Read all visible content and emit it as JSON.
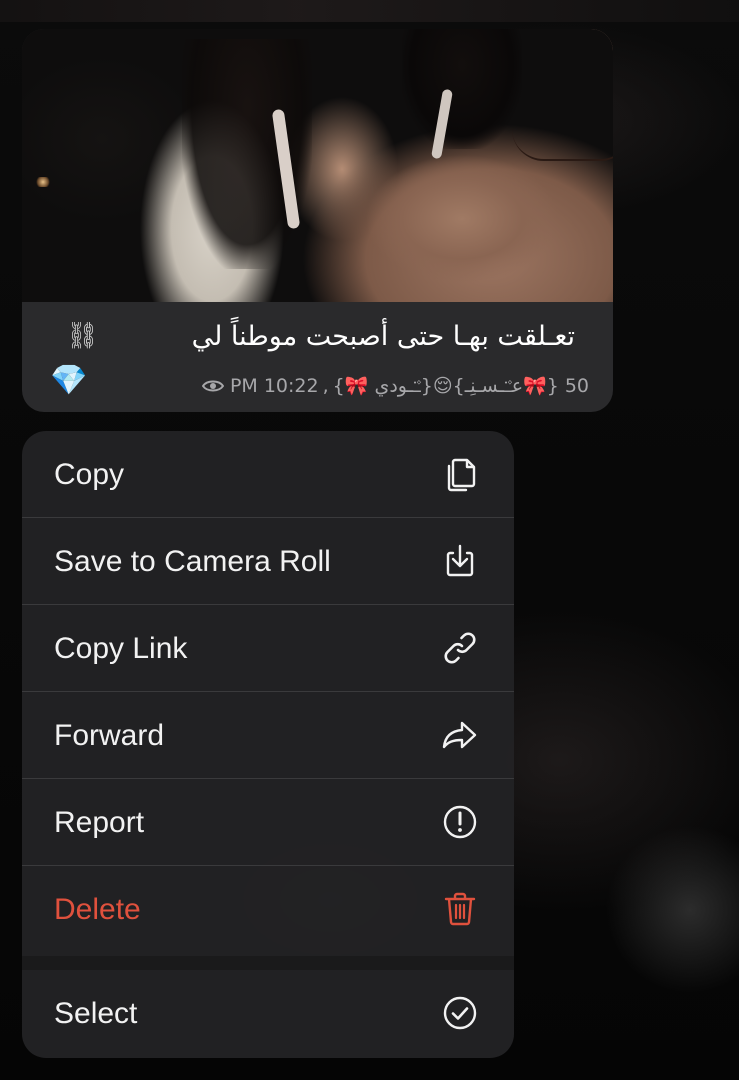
{
  "message": {
    "caption": "تعـلقت بهـا حتى أصبحت موطناً لي",
    "caption_icon": "⛓",
    "reaction_icon": "💎",
    "meta": {
      "views": "50",
      "author": "{🎀عـ۫ـ۬ـسـنِـ}😌{ـ۫ـ۬ـودي 🎀}",
      "time": "PM 10:22"
    }
  },
  "menu": {
    "items": [
      {
        "label": "Copy",
        "icon": "copy-icon"
      },
      {
        "label": "Save to Camera Roll",
        "icon": "download-icon"
      },
      {
        "label": "Copy Link",
        "icon": "link-icon"
      },
      {
        "label": "Forward",
        "icon": "forward-icon"
      },
      {
        "label": "Report",
        "icon": "report-icon"
      },
      {
        "label": "Delete",
        "icon": "trash-icon",
        "color": "#e0513d"
      },
      {
        "label": "Select",
        "icon": "checkmark-circle-icon"
      }
    ]
  }
}
